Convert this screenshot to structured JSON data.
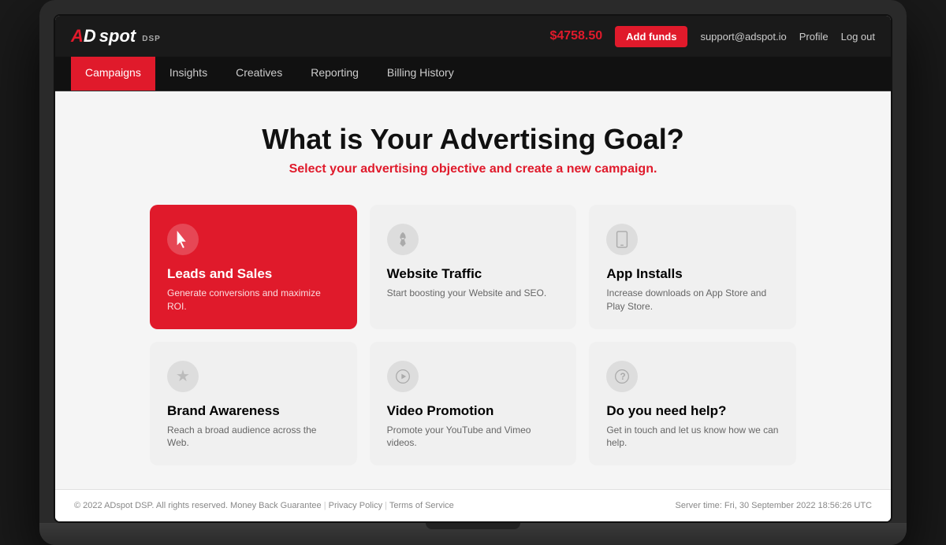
{
  "topbar": {
    "logo_ad": "AD",
    "logo_spot": "spot",
    "logo_dsp": "DSP",
    "balance": "$4758.50",
    "add_funds_label": "Add funds",
    "support_email": "support@adspot.io",
    "profile_label": "Profile",
    "logout_label": "Log out"
  },
  "nav": {
    "tabs": [
      {
        "label": "Campaigns",
        "active": true
      },
      {
        "label": "Insights",
        "active": false
      },
      {
        "label": "Creatives",
        "active": false
      },
      {
        "label": "Reporting",
        "active": false
      },
      {
        "label": "Billing History",
        "active": false
      }
    ]
  },
  "main": {
    "title": "What is Your Advertising Goal?",
    "subtitle": "Select your advertising objective and create a new campaign.",
    "goals": [
      {
        "id": "leads-sales",
        "icon": "cursor",
        "title": "Leads and Sales",
        "desc": "Generate conversions and maximize ROI.",
        "active": true
      },
      {
        "id": "website-traffic",
        "icon": "rocket",
        "title": "Website Traffic",
        "desc": "Start boosting your Website and SEO.",
        "active": false
      },
      {
        "id": "app-installs",
        "icon": "phone",
        "title": "App Installs",
        "desc": "Increase downloads on App Store and Play Store.",
        "active": false
      },
      {
        "id": "brand-awareness",
        "icon": "star",
        "title": "Brand Awareness",
        "desc": "Reach a broad audience across the Web.",
        "active": false
      },
      {
        "id": "video-promotion",
        "icon": "play",
        "title": "Video Promotion",
        "desc": "Promote your YouTube and Vimeo videos.",
        "active": false
      },
      {
        "id": "help",
        "icon": "question",
        "title": "Do you need help?",
        "desc": "Get in touch and let us know how we can help.",
        "active": false
      }
    ]
  },
  "footer": {
    "copyright": "© 2022 ADspot DSP. All rights reserved. Money Back Guarantee",
    "privacy_policy": "Privacy Policy",
    "terms_service": "Terms of Service",
    "divider": "|",
    "server_time": "Server time: Fri, 30 September 2022 18:56:26 UTC"
  }
}
